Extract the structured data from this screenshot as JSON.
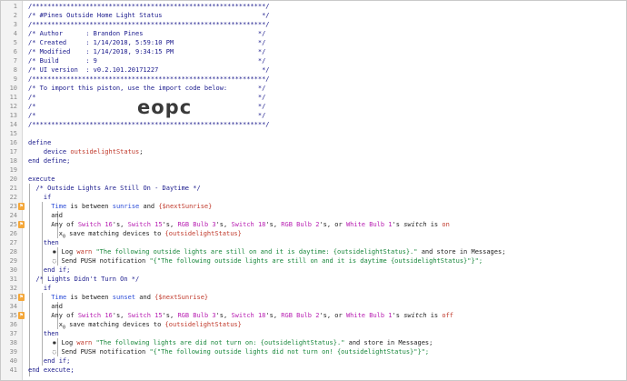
{
  "header": {
    "stars_line": "/*************************************************************/",
    "title_line": "/* #Pines Outside Home Light Status                          */",
    "author_line": "/* Author      : Brandon Pines                              */",
    "created_line": "/* Created     : 1/14/2018, 5:59:10 PM                      */",
    "modified_line": "/* Modified    : 1/14/2018, 9:34:15 PM                      */",
    "build_line": "/* Build       : 9                                          */",
    "ui_line": "/* UI version  : v0.2.101.20171227                           */",
    "import_line": "/* To import this piston, use the import code below:        */",
    "blank_line": "/*                                                          */",
    "import_code": "eopc"
  },
  "code": {
    "define": "define",
    "device_kw": "device",
    "device_name": "outsidelightStatus",
    "end_define": "end define;",
    "execute": "execute",
    "comment1": "/* Outside Lights Are Still On - Daytime */",
    "comment2": "/* Lights Didn't Turn On */",
    "if": "if",
    "then": "then",
    "end_if": "end if;",
    "end_execute": "end execute;",
    "time_word": "Time",
    "is_between": "is between",
    "sunrise": "sunrise",
    "sunset": "sunset",
    "and": "and",
    "next_sunrise": "{$nextSunrise}",
    "any_of": "Any of",
    "switch16": "Switch 16",
    "switch15": "Switch 15",
    "rgb3": "RGB Bulb 3",
    "switch18": "Switch 18",
    "rgb2": "RGB Bulb 2",
    "white1": "White Bulb 1",
    "s_sep": "'s,",
    "s_or": "'s, or",
    "s_end": "'s",
    "switch_attr": "switch",
    "is_word": "is",
    "on": "on",
    "off": "off",
    "save_matching": "save matching devices to",
    "var_ref": "{outsidelightStatus}",
    "log": "Log",
    "warn": "warn",
    "log1_msg": "\"The following outside lights are still on and it is daytime: {outsidelightStatus}.\"",
    "log2_msg": "\"The following lights are did not turn on: {outsidelightStatus}.\"",
    "store_msg": "and store in Messages;",
    "push": "Send PUSH notification",
    "push1_msg": "\"{\"The following outside lights are still on and it is daytime {outsidelightStatus}\"}\";",
    "push2_msg": "\"{\"The following outside lights did not turn on! {outsidelightStatus}\"}\";",
    "semicolon": ";",
    "x_sub": "x",
    "x_idx": "0"
  },
  "line_numbers": [
    "1",
    "2",
    "3",
    "4",
    "5",
    "6",
    "7",
    "8",
    "9",
    "10",
    "11",
    "12",
    "13",
    "14",
    "15",
    "16",
    "17",
    "18",
    "19",
    "20",
    "21",
    "22",
    "23",
    "24",
    "25",
    "26",
    "27",
    "28",
    "29",
    "30",
    "31",
    "32",
    "33",
    "34",
    "35",
    "36",
    "37",
    "38",
    "39",
    "40",
    "41"
  ],
  "flags": {
    "flag_symbol": "⚑"
  },
  "colors": {
    "comment": "#1a1a8c",
    "device": "#c0392b",
    "keyword_blue": "#2a4bd7",
    "device_magenta": "#b81fb2",
    "string_green": "#17863a"
  },
  "icons": {
    "log_icon": "bug-icon",
    "push_icon": "speech-bubble-icon"
  }
}
